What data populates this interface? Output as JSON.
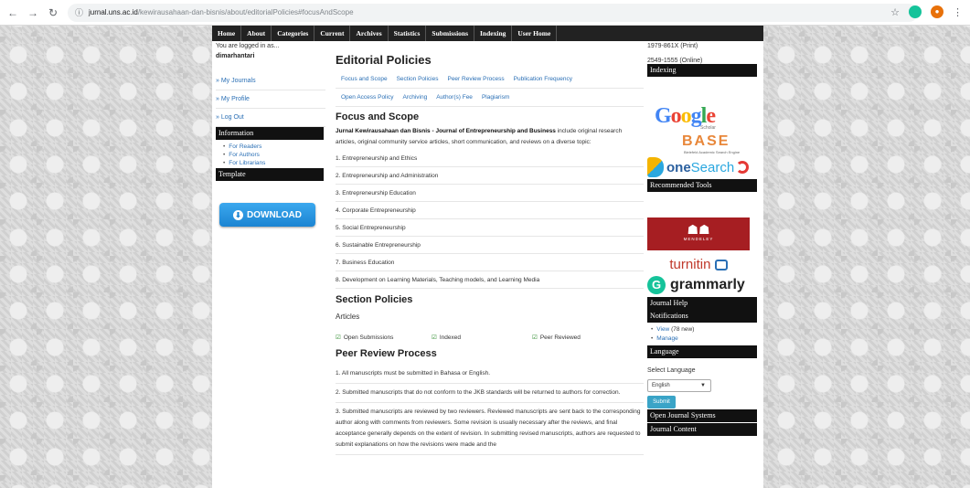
{
  "browser": {
    "url_host": "jurnal.uns.ac.id",
    "url_path": "/kewirausahaan-dan-bisnis/about/editorialPolicies#focusAndScope"
  },
  "topnav": [
    "Home",
    "About",
    "Categories",
    "Current",
    "Archives",
    "Statistics",
    "Submissions",
    "Indexing",
    "User Home"
  ],
  "left": {
    "logged_in_as": "You are logged in as...",
    "username": "dimarhantari",
    "links": [
      "» My Journals",
      "» My Profile",
      "» Log Out"
    ],
    "information_title": "Information",
    "information_links": [
      "For Readers",
      "For Authors",
      "For Librarians"
    ],
    "template_title": "Template",
    "download_label": "DOWNLOAD"
  },
  "main": {
    "title": "Editorial Policies",
    "tabs_row1": [
      "Focus and Scope",
      "Section Policies",
      "Peer Review Process",
      "Publication Frequency"
    ],
    "tabs_row2": [
      "Open Access Policy",
      "Archiving",
      "Author(s) Fee",
      "Plagiarism"
    ],
    "focus_heading": "Focus and Scope",
    "focus_journal_name": "Jurnal Kewirausahaan dan Bisnis - Journal of Entrepreneurship and Business",
    "focus_text": " include original research articles, original community service articles, short communication, and reviews on a diverse topic:",
    "focus_list": [
      "1. Entrepreneurship and Ethics",
      "2. Entrepreneurship and Administration",
      "3. Entrepreneurship Education",
      "4. Corporate Entrepreneurship",
      "5. Social Entrepreneurship",
      "6. Sustainable Entrepreneurship",
      "7. Business Education",
      "8. Development on Learning Materials, Teaching models, and Learning Media"
    ],
    "section_heading": "Section Policies",
    "articles_label": "Articles",
    "section_policies": [
      "Open Submissions",
      "Indexed",
      "Peer Reviewed"
    ],
    "peer_heading": "Peer Review Process",
    "peer_list": [
      "1. All manuscripts must be submitted in Bahasa or English.",
      "2. Submitted manuscripts that do not conform to the JKB standards will be returned to authors for correction.",
      "3. Submitted manuscripts are reviewed by two reviewers. Reviewed manuscripts are sent back to the corresponding author along with comments from reviewers. Some revision is usually necessary after the reviews, and final acceptance generally depends on the extent of revision. In submitting revised manuscripts, authors are requested to submit explanations on how the revisions were made and the"
    ]
  },
  "right": {
    "issn_print": "1979-861X (Print)",
    "issn_online": "2549-1555 (Online)",
    "indexing_title": "Indexing",
    "google_text": "Google",
    "scholar_text": "Scholar",
    "base_text": "BASE",
    "base_sub": "Bielefeld Academic Search Engine",
    "one_text": "one",
    "search_text": "Search",
    "recommended_title": "Recommended Tools",
    "mendeley_text": "MENDELEY",
    "turnitin_text": "turnitin",
    "grammarly_text": "grammarly",
    "journal_help_title": "Journal Help",
    "notifications_title": "Notifications",
    "view_label": "View",
    "view_count": "(78 new)",
    "manage_label": "Manage",
    "language_title": "Language",
    "select_language_label": "Select Language",
    "language_value": "English",
    "submit_label": "Submit",
    "ojs_title": "Open Journal Systems",
    "journal_content_title": "Journal Content"
  }
}
